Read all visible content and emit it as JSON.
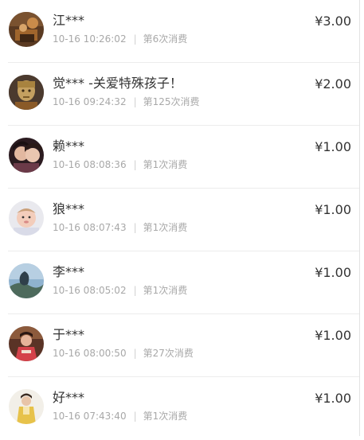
{
  "donations": [
    {
      "name": "江***",
      "time": "10-16 10:26:02",
      "sep": "|",
      "count": "第6次消费",
      "amount": "¥3.00"
    },
    {
      "name": "觉*** -关爱特殊孩子！",
      "time": "10-16 09:24:32",
      "sep": "|",
      "count": "第125次消费",
      "amount": "¥2.00"
    },
    {
      "name": "赖***",
      "time": "10-16 08:08:36",
      "sep": "|",
      "count": "第1次消费",
      "amount": "¥1.00"
    },
    {
      "name": "狼***",
      "time": "10-16 08:07:43",
      "sep": "|",
      "count": "第1次消费",
      "amount": "¥1.00"
    },
    {
      "name": "李***",
      "time": "10-16 08:05:02",
      "sep": "|",
      "count": "第1次消费",
      "amount": "¥1.00"
    },
    {
      "name": "于***",
      "time": "10-16 08:00:50",
      "sep": "|",
      "count": "第27次消费",
      "amount": "¥1.00"
    },
    {
      "name": "好***",
      "time": "10-16 07:43:40",
      "sep": "|",
      "count": "第1次消费",
      "amount": "¥1.00"
    }
  ]
}
